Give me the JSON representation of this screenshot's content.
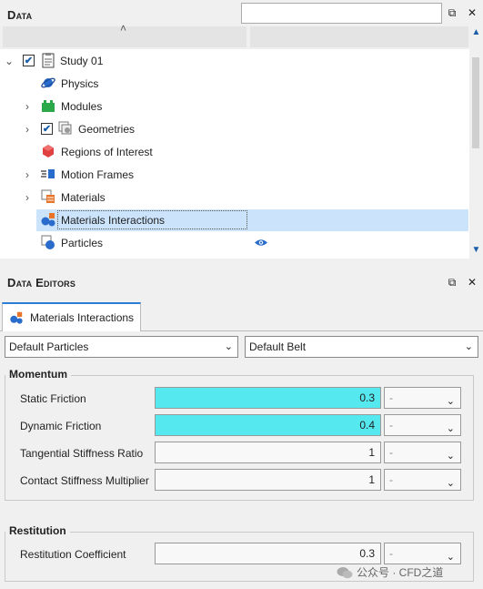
{
  "data_panel": {
    "title": "Data",
    "search": {
      "value": "",
      "placeholder": ""
    },
    "tree": [
      {
        "label": "Study 01",
        "expand": "collapse",
        "checked": true,
        "icon": "clipboard-icon"
      },
      {
        "label": "Physics",
        "icon": "physics-icon"
      },
      {
        "label": "Modules",
        "expand": "expand",
        "icon": "modules-icon"
      },
      {
        "label": "Geometries",
        "expand": "expand",
        "checked": true,
        "icon": "geometries-icon"
      },
      {
        "label": "Regions of Interest",
        "icon": "regions-icon"
      },
      {
        "label": "Motion Frames",
        "expand": "expand",
        "icon": "motion-frames-icon"
      },
      {
        "label": "Materials",
        "expand": "expand",
        "icon": "materials-icon"
      },
      {
        "label": "Materials Interactions",
        "selected": true,
        "icon": "materials-interactions-icon"
      },
      {
        "label": "Particles",
        "icon": "particles-icon",
        "visible": true
      }
    ]
  },
  "editors_panel": {
    "title": "Data Editors",
    "tab_label": "Materials Interactions",
    "material_a": "Default Particles",
    "material_b": "Default Belt",
    "momentum": {
      "title": "Momentum",
      "rows": [
        {
          "label": "Static Friction",
          "value": "0.3",
          "unit": "-",
          "highlight": true
        },
        {
          "label": "Dynamic Friction",
          "value": "0.4",
          "unit": "-",
          "highlight": true
        },
        {
          "label": "Tangential Stiffness Ratio",
          "value": "1",
          "unit": "-"
        },
        {
          "label": "Contact Stiffness Multiplier",
          "value": "1",
          "unit": "-"
        }
      ]
    },
    "restitution": {
      "title": "Restitution",
      "rows": [
        {
          "label": "Restitution Coefficient",
          "value": "0.3",
          "unit": "-"
        }
      ]
    }
  },
  "watermark": "公众号 · CFD之道",
  "colors": {
    "accent": "#2a7fd4",
    "highlight": "#55e8ee",
    "selection": "#cce4fb"
  }
}
